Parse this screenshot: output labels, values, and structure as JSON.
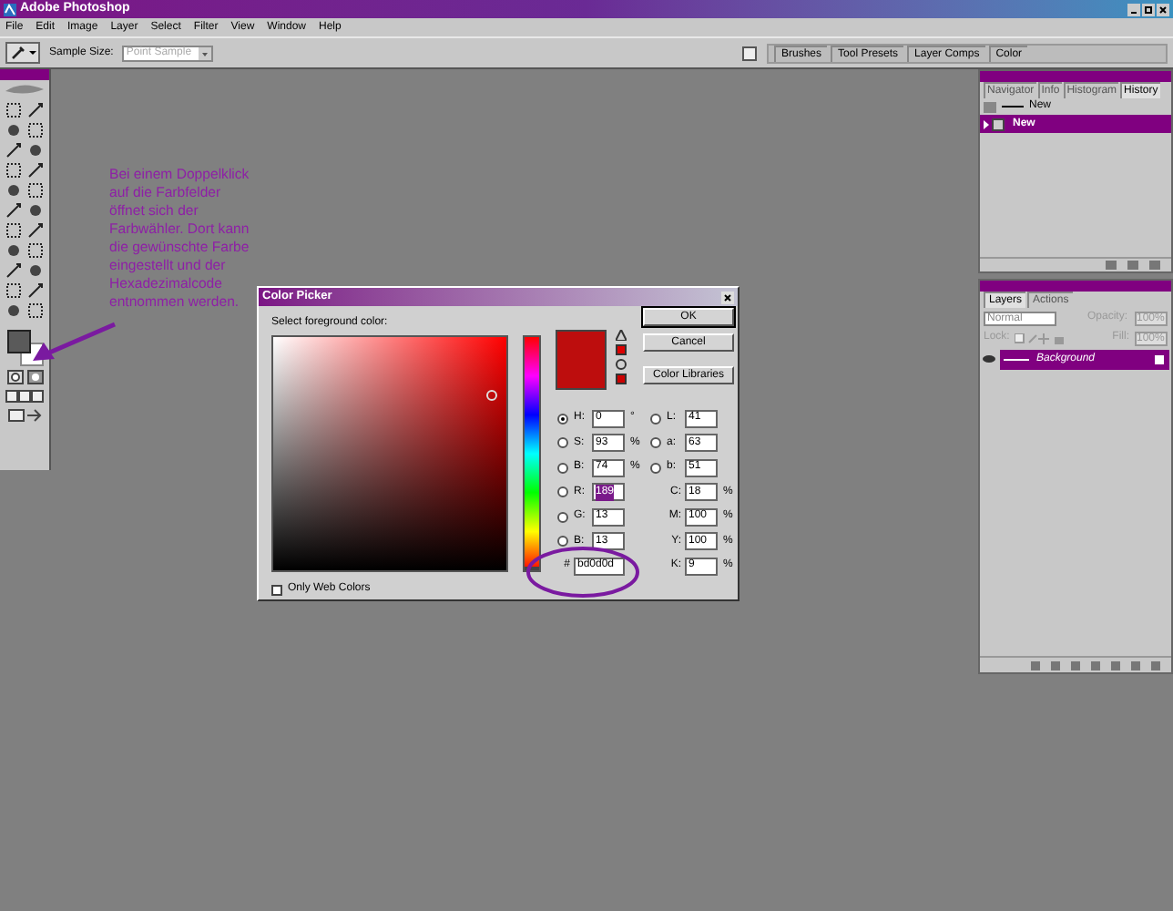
{
  "window": {
    "title": "Adobe Photoshop"
  },
  "menu": [
    "File",
    "Edit",
    "Image",
    "Layer",
    "Select",
    "Filter",
    "View",
    "Window",
    "Help"
  ],
  "options_bar": {
    "sample_size_label": "Sample Size:",
    "sample_size_value": "Point Sample"
  },
  "palette_well_tabs": [
    "Brushes",
    "Tool Presets",
    "Layer Comps",
    "Color"
  ],
  "annotation_lines": [
    "Bei einem Doppelklick",
    "auf die Farbfelder",
    "öffnet sich der",
    "Farbwähler. Dort kann",
    "die gewünschte Farbe",
    "eingestellt und der",
    "Hexadezimalcode",
    "entnommen werden."
  ],
  "history_panel": {
    "tabs": [
      {
        "label": "Navigator",
        "selected": false
      },
      {
        "label": "Info",
        "selected": false
      },
      {
        "label": "Histogram",
        "selected": false
      },
      {
        "label": "History",
        "selected": true
      }
    ],
    "snapshot": "New",
    "states": [
      {
        "label": "New",
        "selected": true
      }
    ]
  },
  "layers_panel": {
    "tabs": [
      {
        "label": "Layers",
        "selected": true
      },
      {
        "label": "Actions",
        "selected": false
      }
    ],
    "blend_mode": "Normal",
    "opacity_label": "Opacity:",
    "opacity": "100%",
    "lock_label": "Lock:",
    "fill_label": "Fill:",
    "fill": "100%",
    "layers": [
      {
        "name": "Background",
        "selected": true
      }
    ]
  },
  "color_picker": {
    "title": "Color Picker",
    "prompt": "Select foreground color:",
    "buttons": [
      "OK",
      "Cancel",
      "Color Libraries"
    ],
    "hue_slider": {
      "level": 0
    },
    "left_fields": [
      {
        "kind": "radio",
        "label": "H:",
        "value": "0",
        "unit": "°",
        "selected": true,
        "highlighted": false
      },
      {
        "kind": "radio",
        "label": "S:",
        "value": "93",
        "unit": "%",
        "selected": false,
        "highlighted": false
      },
      {
        "kind": "radio",
        "label": "B:",
        "value": "74",
        "unit": "%",
        "selected": false,
        "highlighted": false
      },
      {
        "kind": "radio",
        "label": "R:",
        "value": "189",
        "selected": false,
        "highlighted": true
      },
      {
        "kind": "radio",
        "label": "G:",
        "value": "13",
        "selected": false,
        "highlighted": false
      },
      {
        "kind": "radio",
        "label": "B:",
        "value": "13",
        "selected": false,
        "highlighted": false
      }
    ],
    "right_fields": [
      {
        "kind": "radio",
        "label": "L:",
        "value": "41",
        "selected": false
      },
      {
        "kind": "radio",
        "label": "a:",
        "value": "63",
        "selected": false
      },
      {
        "kind": "radio",
        "label": "b:",
        "value": "51",
        "selected": false
      },
      {
        "kind": "plain",
        "label": "C:",
        "value": "18",
        "unit": "%"
      },
      {
        "kind": "plain",
        "label": "M:",
        "value": "100",
        "unit": "%"
      },
      {
        "kind": "plain",
        "label": "Y:",
        "value": "100",
        "unit": "%"
      },
      {
        "kind": "plain",
        "label": "K:",
        "value": "9",
        "unit": "%"
      }
    ],
    "hex_label": "#",
    "hex": "bd0d0d",
    "only_web_colors": {
      "label": "Only Web Colors",
      "checked": false
    }
  }
}
